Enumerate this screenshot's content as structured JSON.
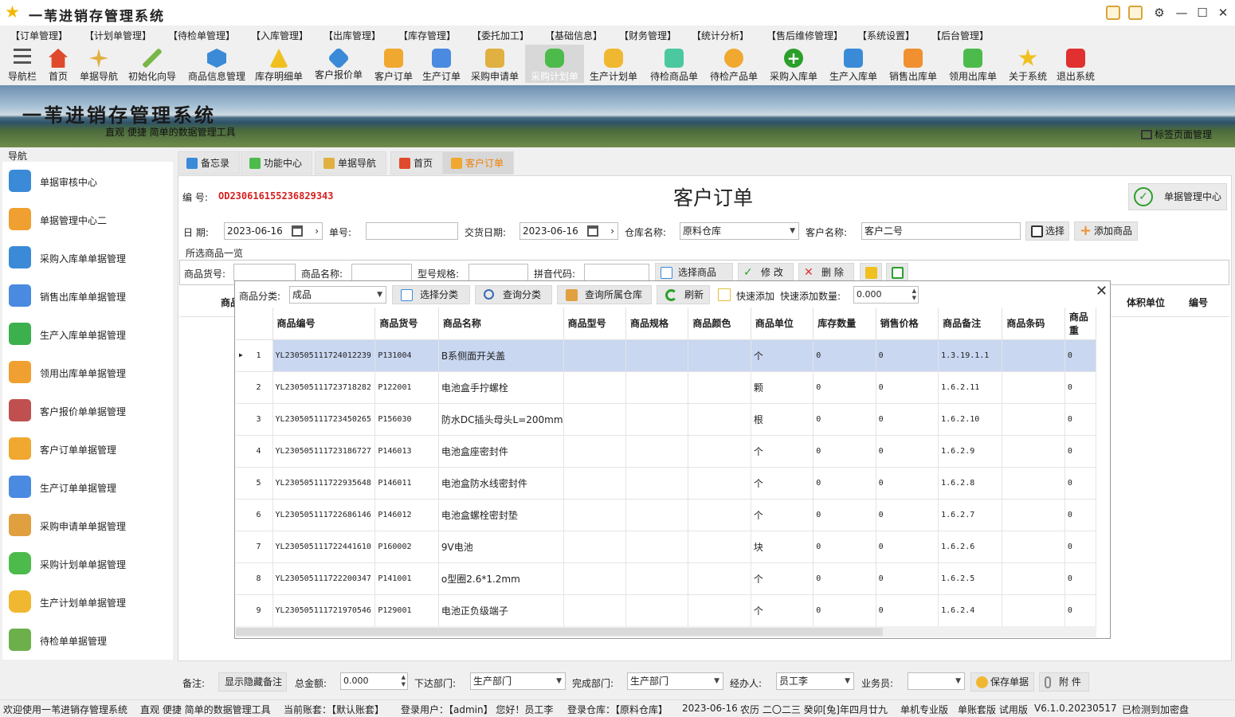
{
  "app": {
    "title": "一苇进销存管理系统"
  },
  "menu": [
    "【订单管理】",
    "【计划单管理】",
    "【待检单管理】",
    "【入库管理】",
    "【出库管理】",
    "【库存管理】",
    "【委托加工】",
    "【基础信息】",
    "【财务管理】",
    "【统计分析】",
    "【售后维修管理】",
    "【系统设置】",
    "【后台管理】"
  ],
  "toolbar": [
    {
      "label": "导航栏",
      "icon": "list-icon",
      "color": "#555555"
    },
    {
      "label": "首页",
      "icon": "home-icon",
      "color": "#e04a2c"
    },
    {
      "label": "单据导航",
      "icon": "compass-icon",
      "color": "#e0b040"
    },
    {
      "label": "初始化向导",
      "icon": "wand-icon",
      "color": "#7ab648"
    },
    {
      "label": "商品信息管理",
      "icon": "cubes-icon",
      "color": "#3a8ad8"
    },
    {
      "label": "库存明细单",
      "icon": "warning-icon",
      "color": "#f0c020"
    },
    {
      "label": "客户报价单",
      "icon": "tag-icon",
      "color": "#3a8ad8"
    },
    {
      "label": "客户订单",
      "icon": "orange-doc-icon",
      "color": "#f0a830"
    },
    {
      "label": "生产订单",
      "icon": "blue-doc-icon",
      "color": "#4a8ae0"
    },
    {
      "label": "采购申请单",
      "icon": "pencil-note-icon",
      "color": "#e0b040"
    },
    {
      "label": "采购计划单",
      "icon": "green-chat-icon",
      "color": "#4cbb4c"
    },
    {
      "label": "生产计划单",
      "icon": "yellow-chat-icon",
      "color": "#f0b830"
    },
    {
      "label": "待检商品单",
      "icon": "flask-icon",
      "color": "#4cc8a0"
    },
    {
      "label": "待检产品单",
      "icon": "beaker-icon",
      "color": "#f0a830"
    },
    {
      "label": "采购入库单",
      "icon": "plus-circle-icon",
      "color": "#2aa02a"
    },
    {
      "label": "生产入库单",
      "icon": "trolley-icon",
      "color": "#3a8ad8"
    },
    {
      "label": "销售出库单",
      "icon": "export-icon",
      "color": "#f09030"
    },
    {
      "label": "领用出库单",
      "icon": "download-icon",
      "color": "#4cbb4c"
    },
    {
      "label": "关于系统",
      "icon": "star-icon",
      "color": "#f0c020"
    },
    {
      "label": "退出系统",
      "icon": "exit-icon",
      "color": "#e03030"
    }
  ],
  "banner": {
    "title": "一苇进销存管理系统",
    "subtitle": "直观 便捷 简单的数据管理工具",
    "tag_manager": "标签页面管理"
  },
  "nav": {
    "label": "导航",
    "items": [
      {
        "label": "单据审核中心",
        "color": "#3a8ad8"
      },
      {
        "label": "单据管理中心二",
        "color": "#f0a030"
      },
      {
        "label": "采购入库单单据管理",
        "color": "#3a8ad8"
      },
      {
        "label": "销售出库单单据管理",
        "color": "#4a8ae0"
      },
      {
        "label": "生产入库单单据管理",
        "color": "#3cb04c"
      },
      {
        "label": "领用出库单单据管理",
        "color": "#f0a030"
      },
      {
        "label": "客户报价单单据管理",
        "color": "#c05050"
      },
      {
        "label": "客户订单单据管理",
        "color": "#f0a830"
      },
      {
        "label": "生产订单单据管理",
        "color": "#4a8ae0"
      },
      {
        "label": "采购申请单单据管理",
        "color": "#e0a040"
      },
      {
        "label": "采购计划单单据管理",
        "color": "#4cbb4c"
      },
      {
        "label": "生产计划单单据管理",
        "color": "#f0b830"
      },
      {
        "label": "待检单单据管理",
        "color": "#6cb04c"
      }
    ]
  },
  "tabs": [
    {
      "label": "备忘录",
      "color": "#3a8ad8"
    },
    {
      "label": "功能中心",
      "color": "#4cbb4c"
    },
    {
      "label": "单据导航",
      "color": "#e0b040"
    },
    {
      "label": "首页",
      "color": "#e04a2c"
    },
    {
      "label": "客户订单",
      "color": "#f0a830"
    }
  ],
  "form": {
    "code_label": "编 号:",
    "code_value": "OD230616155236829343",
    "page_title": "客户订单",
    "doc_center": "单据管理中心",
    "date_label": "日 期:",
    "date_value": "2023-06-16",
    "no_label": "单号:",
    "no_value": "",
    "delivery_label": "交货日期:",
    "delivery_value": "2023-06-16",
    "warehouse_label": "仓库名称:",
    "warehouse_value": "原料仓库",
    "customer_label": "客户名称:",
    "customer_value": "客户二号",
    "choose_btn": "选择",
    "add_goods_btn": "添加商品",
    "selected_section": "所选商品一览",
    "goods_no_label": "商品货号:",
    "goods_name_label": "商品名称:",
    "model_label": "型号规格:",
    "pinyin_label": "拼音代码:",
    "select_goods_btn": "选择商品",
    "edit_btn": "修 改",
    "delete_btn": "删 除",
    "col_goods_partial": "商品",
    "col_volume_unit": "体积单位",
    "col_no": "编号"
  },
  "popup": {
    "category_label": "商品分类:",
    "category_value": "成品",
    "select_category_btn": "选择分类",
    "query_category_btn": "查询分类",
    "query_warehouse_btn": "查询所属仓库",
    "refresh_btn": "刷新",
    "quick_add_label": "快速添加",
    "quick_qty_label": "快速添加数量:",
    "quick_qty_value": "0.000",
    "columns": [
      "商品编号",
      "商品货号",
      "商品名称",
      "商品型号",
      "商品规格",
      "商品颜色",
      "商品单位",
      "库存数量",
      "销售价格",
      "商品备注",
      "商品条码",
      "商品重"
    ],
    "rows": [
      {
        "n": "1",
        "code": "YL230505111724012239",
        "sku": "P131004",
        "name": "B系侧面开关盖",
        "unit": "个",
        "stock": "0",
        "price": "0",
        "remark": "1.3.19.1.1",
        "weight": "0"
      },
      {
        "n": "2",
        "code": "YL230505111723718282",
        "sku": "P122001",
        "name": "电池盒手拧螺栓",
        "unit": "颗",
        "stock": "0",
        "price": "0",
        "remark": "1.6.2.11",
        "weight": "0"
      },
      {
        "n": "3",
        "code": "YL230505111723450265",
        "sku": "P156030",
        "name": "防水DC插头母头L=200mm",
        "unit": "根",
        "stock": "0",
        "price": "0",
        "remark": "1.6.2.10",
        "weight": "0"
      },
      {
        "n": "4",
        "code": "YL230505111723186727",
        "sku": "P146013",
        "name": "电池盒座密封件",
        "unit": "个",
        "stock": "0",
        "price": "0",
        "remark": "1.6.2.9",
        "weight": "0"
      },
      {
        "n": "5",
        "code": "YL230505111722935648",
        "sku": "P146011",
        "name": "电池盒防水线密封件",
        "unit": "个",
        "stock": "0",
        "price": "0",
        "remark": "1.6.2.8",
        "weight": "0"
      },
      {
        "n": "6",
        "code": "YL230505111722686146",
        "sku": "P146012",
        "name": "电池盒螺栓密封垫",
        "unit": "个",
        "stock": "0",
        "price": "0",
        "remark": "1.6.2.7",
        "weight": "0"
      },
      {
        "n": "7",
        "code": "YL230505111722441610",
        "sku": "P160002",
        "name": "9V电池",
        "unit": "块",
        "stock": "0",
        "price": "0",
        "remark": "1.6.2.6",
        "weight": "0"
      },
      {
        "n": "8",
        "code": "YL230505111722200347",
        "sku": "P141001",
        "name": "o型圈2.6*1.2mm",
        "unit": "个",
        "stock": "0",
        "price": "0",
        "remark": "1.6.2.5",
        "weight": "0"
      },
      {
        "n": "9",
        "code": "YL230505111721970546",
        "sku": "P129001",
        "name": "电池正负级端子",
        "unit": "个",
        "stock": "0",
        "price": "0",
        "remark": "1.6.2.4",
        "weight": "0"
      }
    ]
  },
  "footer": {
    "remark_label": "备注:",
    "toggle_remark_btn": "显示隐藏备注",
    "total_label": "总金额:",
    "total_value": "0.000",
    "issue_dept_label": "下达部门:",
    "issue_dept_value": "生产部门",
    "done_dept_label": "完成部门:",
    "done_dept_value": "生产部门",
    "handler_label": "经办人:",
    "handler_value": "员工李",
    "sales_label": "业务员:",
    "sales_value": "",
    "save_btn": "保存单据",
    "attach_btn": "附 件"
  },
  "status": {
    "welcome": "欢迎使用一苇进销存管理系统",
    "tagline": "直观 便捷 简单的数据管理工具",
    "account": "当前账套：【默认账套】",
    "user": "登录用户：【admin】 您好！员工李",
    "warehouse": "登录仓库：【原料仓库】",
    "date": "2023-06-16",
    "lunar": "农历 二〇二三 癸卯[兔]年四月廿九",
    "edition": "单机专业版",
    "edition2": "单账套版 试用版",
    "version": "V6.1.0.20230517",
    "dongle": "已检测到加密盘"
  }
}
